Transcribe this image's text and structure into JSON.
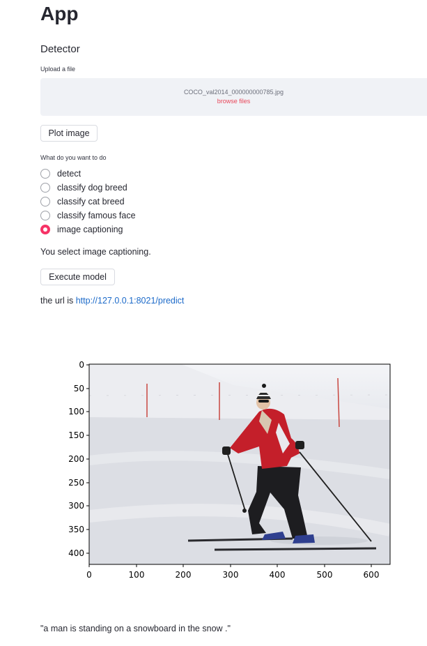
{
  "app": {
    "title": "App",
    "subtitle": "Detector"
  },
  "uploader": {
    "label": "Upload a file",
    "file_name": "COCO_val2014_000000000785.jpg",
    "browse_label": "browse files"
  },
  "buttons": {
    "plot": "Plot image",
    "execute": "Execute model"
  },
  "task": {
    "question": "What do you want to do",
    "options": [
      "detect",
      "classify dog breed",
      "classify cat breed",
      "classify famous face",
      "image captioning"
    ],
    "selected_index": 4,
    "selected_message": "You select image captioning."
  },
  "endpoint": {
    "prefix": "the url is ",
    "url": "http://127.0.0.1:8021/predict"
  },
  "plot": {
    "y_ticks": [
      "0",
      "50",
      "100",
      "150",
      "200",
      "250",
      "300",
      "350",
      "400"
    ],
    "x_ticks": [
      "0",
      "100",
      "200",
      "300",
      "400",
      "500",
      "600"
    ]
  },
  "caption": "\"a man is standing on a snowboard in the snow .\"",
  "colors": {
    "accent": "#f63366",
    "link": "#1c6ac9",
    "dropzone_bg": "#f0f2f6"
  }
}
